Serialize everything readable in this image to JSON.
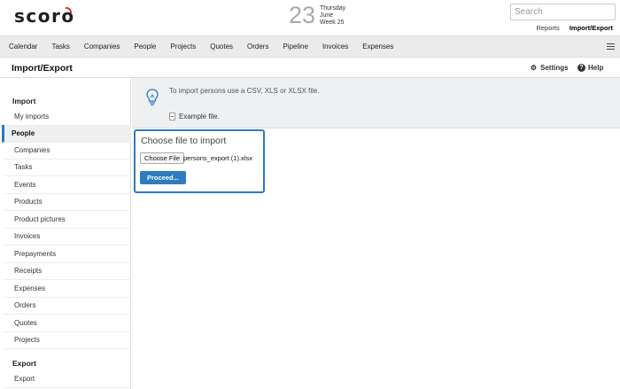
{
  "header": {
    "logo_text": "scoro",
    "date": {
      "day": "23",
      "weekday": "Thursday",
      "month": "June",
      "week": "Week 25"
    },
    "search_placeholder": "Search",
    "links": [
      {
        "label": "Reports",
        "active": false
      },
      {
        "label": "Import/Export",
        "active": true
      }
    ]
  },
  "nav": {
    "items": [
      "Calendar",
      "Tasks",
      "Companies",
      "People",
      "Projects",
      "Quotes",
      "Orders",
      "Pipeline",
      "Invoices",
      "Expenses"
    ],
    "menu_icon": "hamburger-icon"
  },
  "page": {
    "title": "Import/Export",
    "settings_label": "Settings",
    "help_label": "Help"
  },
  "sidebar": {
    "sections": [
      {
        "heading": "Import",
        "items": [
          "My imports",
          "People",
          "Companies",
          "Tasks",
          "Events",
          "Products",
          "Product pictures",
          "Invoices",
          "Prepayments",
          "Receipts",
          "Expenses",
          "Orders",
          "Quotes",
          "Projects"
        ]
      },
      {
        "heading": "Export",
        "items": [
          "Export"
        ]
      }
    ],
    "active_item": "People"
  },
  "info": {
    "text": "To import persons use a CSV, XLS or XLSX file.",
    "example_label": "Example file."
  },
  "upload": {
    "title": "Choose file to import",
    "choose_label": "Choose File",
    "file_name": "persons_export (1).xlsx",
    "proceed_label": "Proceed..."
  },
  "colors": {
    "accent": "#2d7bc1",
    "logo_mark": "#d8322c",
    "nav_bg": "#ebebeb",
    "info_bg": "#eef0f2"
  }
}
